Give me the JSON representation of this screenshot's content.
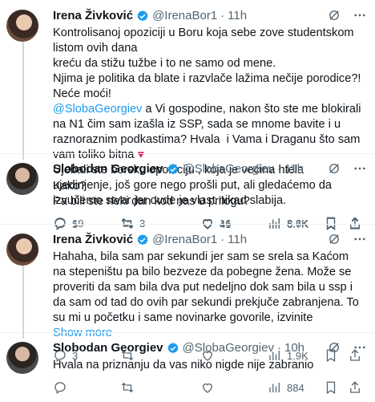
{
  "colors": {
    "accent": "#1d9bf0",
    "muted": "#536471",
    "text": "#0f1419",
    "heart": "#e0245e"
  },
  "tweets": [
    {
      "name": "Irena Živković",
      "handle": "@IrenaBor1",
      "dot": "·",
      "time": "11h",
      "lines": [
        "Kontrolisanoj opoziciji u Boru koja sebe zove studentskom listom ovih dana",
        "kreću da stižu tužbe i to ne samo od mene.",
        "Njima je politika da blate i razvlače lažima nečije porodice?! Neće moći!"
      ],
      "mention": "@SlobaGeorgiev",
      "mention_rest": " a Vi gospodine, nakon što ste me blokirali na N1 čim sam izašla iz SSP, sada se mnome bavite i u raznoraznim podkastima? Hvala  i Vama i Draganu što sam vam toliko bitna ",
      "heart": "♥",
      "tail": "Ujebali ste borsku opoziciju , koja je većina htela ujedinjenje, još gore nego prošli put, ali gledaćemo da izvučemo stvar jer ovde je vlast nikad slabija.",
      "replies": "19",
      "retweets": "3",
      "likes": "16",
      "views": "8.6K"
    },
    {
      "name": "Slobodan Georgiev",
      "handle": "@SlobaGeorgiev",
      "dot": "·",
      "time": "11h",
      "text": "Kako?\nPa bili ste neki dan kod nas u prilogu?",
      "replies": "5",
      "retweets": "",
      "likes": "41",
      "views": "6.7K"
    },
    {
      "name": "Irena Živković",
      "handle": "@IrenaBor1",
      "dot": "·",
      "time": "11h",
      "text": "Hahaha, bila sam par sekundi jer sam se srela sa Kaćom na stepeništu pa bilo bezveze da pobegne žena. Može se proveriti da sam bila dva put nedeljno dok sam bila u ssp i da sam od tad do ovih par sekundi prekjuče zabranjena. To su mi u početku i same novinarke govorile, izvinite",
      "show_more": "Show more",
      "replies": "3",
      "retweets": "",
      "likes": "",
      "views": "1.9K"
    },
    {
      "name": "Slobodan Georgiev",
      "handle": "@SlobaGeorgiev",
      "dot": "·",
      "time": "10h",
      "text": "Hvala na priznanju da vas niko nigde nije zabranio",
      "replies": "",
      "retweets": "",
      "likes": "",
      "views": "884"
    }
  ]
}
